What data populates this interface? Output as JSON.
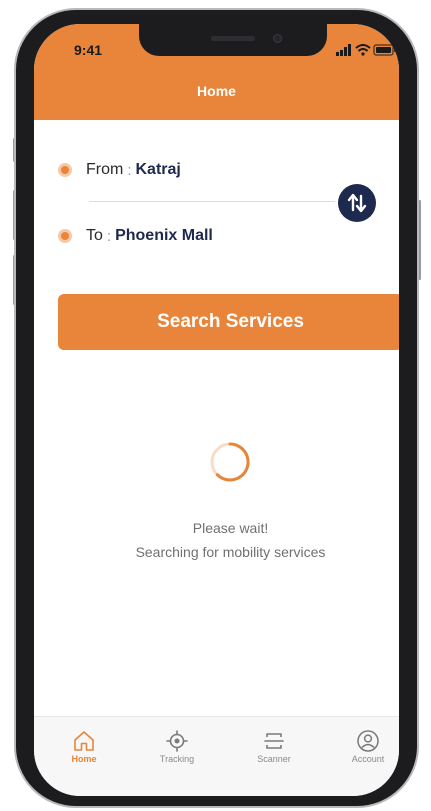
{
  "status_bar": {
    "time": "9:41"
  },
  "header": {
    "title": "Home"
  },
  "route": {
    "from_label": "From",
    "from_value": "Katraj",
    "to_label": "To",
    "to_value": "Phoenix Mall",
    "separator": ":"
  },
  "search_button": {
    "label": "Search Services"
  },
  "loading": {
    "line1": "Please wait!",
    "line2": "Searching for mobility services"
  },
  "tabs": [
    {
      "label": "Home",
      "icon": "home-icon",
      "active": true
    },
    {
      "label": "Tracking",
      "icon": "crosshair-icon",
      "active": false
    },
    {
      "label": "Scanner",
      "icon": "scanner-icon",
      "active": false
    },
    {
      "label": "Account",
      "icon": "user-icon",
      "active": false
    }
  ],
  "colors": {
    "accent": "#e8853a",
    "navy": "#1d2a4d",
    "muted_text": "#707070"
  }
}
